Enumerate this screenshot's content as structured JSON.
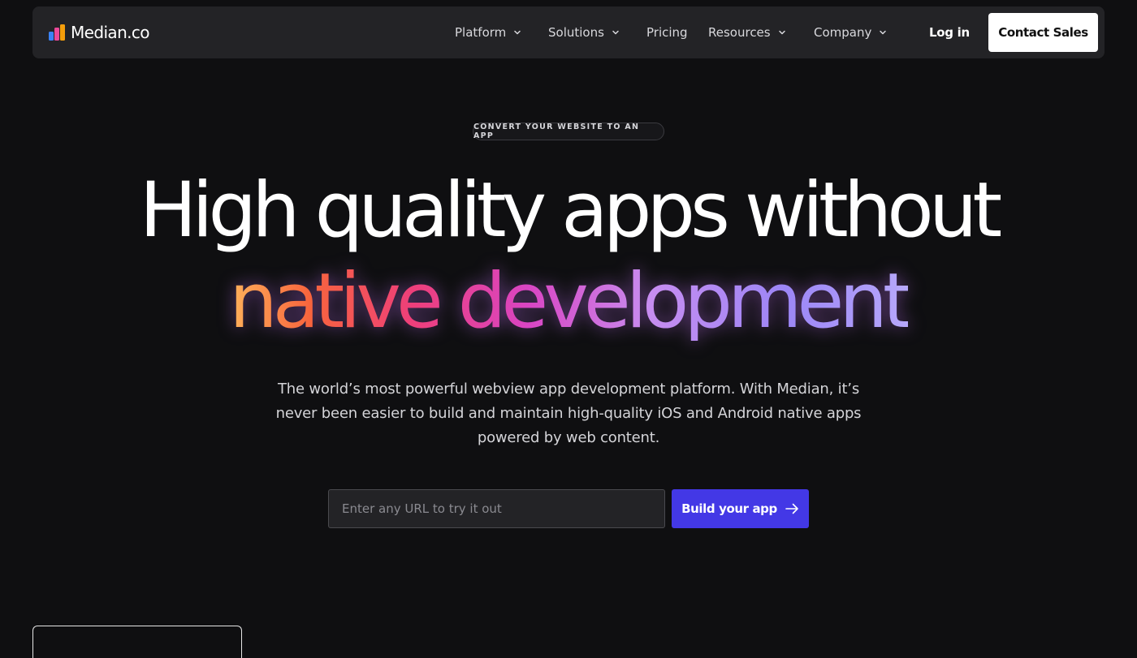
{
  "brand": {
    "name": "Median.co",
    "logo_colors": [
      "#3b82f6",
      "#ec4899",
      "#f59e0b"
    ]
  },
  "nav": {
    "items": [
      {
        "label": "Platform",
        "dropdown": true
      },
      {
        "label": "Solutions",
        "dropdown": true
      },
      {
        "label": "Pricing",
        "dropdown": false
      },
      {
        "label": "Resources",
        "dropdown": true
      },
      {
        "label": "Company",
        "dropdown": true
      }
    ],
    "login_label": "Log in",
    "contact_label": "Contact Sales"
  },
  "hero": {
    "badge": "CONVERT YOUR WEBSITE TO AN APP",
    "headline_line1": "High quality apps without",
    "headline_line2": "native development",
    "subtext": "The world’s most powerful webview app development platform. With Median, it’s never been easier to build and maintain high-quality iOS and Android native apps powered by web content.",
    "url_placeholder": "Enter any URL to try it out",
    "url_value": "",
    "cta_label": "Build your app"
  },
  "colors": {
    "background": "#0f0f11",
    "nav_background": "#232326",
    "accent": "#4338e6",
    "gradient": [
      "#ffb25a",
      "#f7643d",
      "#ee3f7a",
      "#d945c3",
      "#c78df0",
      "#9c86f6",
      "#b7a8fb"
    ]
  },
  "icons": {
    "nav_dropdown": "chevron-down-icon",
    "cta": "arrow-right-icon",
    "logo": "bar-chart-logo-icon"
  }
}
